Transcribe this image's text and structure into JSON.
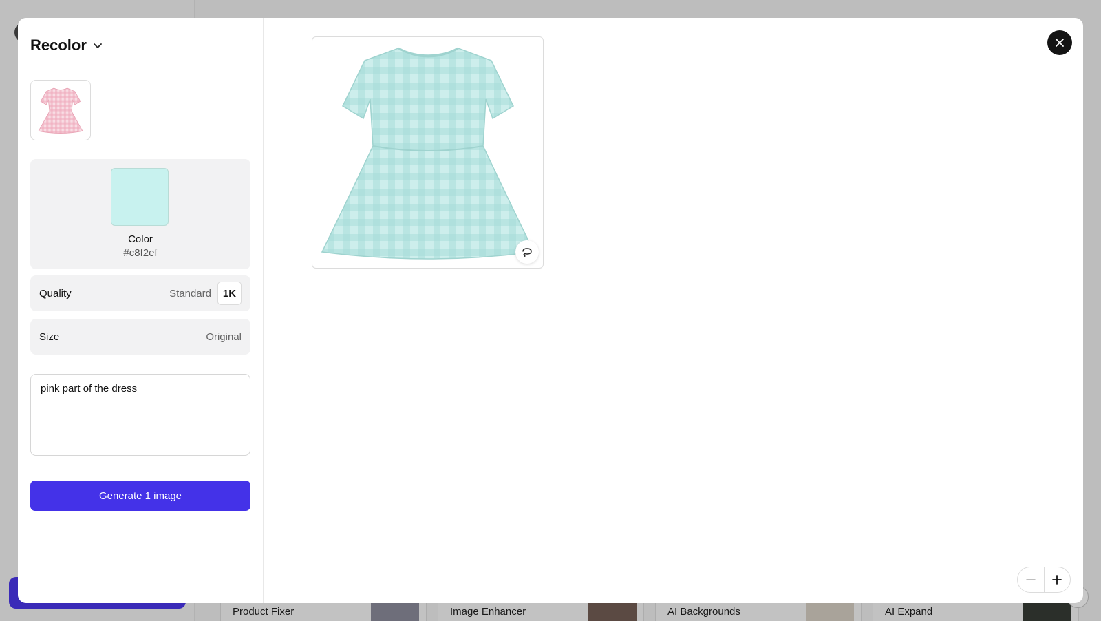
{
  "background": {
    "tools": [
      {
        "label": "Product Fixer"
      },
      {
        "label": "Image Enhancer"
      },
      {
        "label": "AI Backgrounds"
      },
      {
        "label": "AI Expand"
      }
    ]
  },
  "modal": {
    "tool_title": "Recolor",
    "color": {
      "label": "Color",
      "hex_text": "#c8f2ef",
      "value": "#c8f2ef"
    },
    "quality": {
      "label": "Quality",
      "value": "Standard",
      "badge": "1K"
    },
    "size": {
      "label": "Size",
      "value": "Original"
    },
    "prompt": {
      "value": "pink part of the dress"
    },
    "generate_button": "Generate 1 image"
  },
  "colors": {
    "accent": "#4432e8",
    "source_dress": "#f2b7c6",
    "result_dress": "#bfe9e7"
  },
  "icons": [
    "chevron-down-icon",
    "close-icon",
    "variation-icon",
    "zoom-out-icon",
    "zoom-in-icon"
  ]
}
